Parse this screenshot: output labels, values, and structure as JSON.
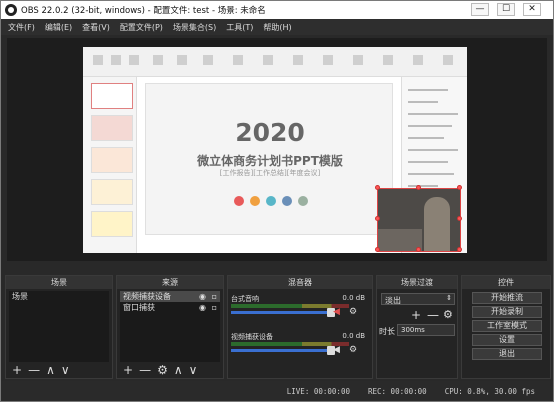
{
  "window": {
    "title": "OBS 22.0.2 (32-bit, windows) - 配置文件: test - 场景: 未命名",
    "minimize": "—",
    "maximize": "☐",
    "close": "✕"
  },
  "menu": [
    "文件(F)",
    "编辑(E)",
    "查看(V)",
    "配置文件(P)",
    "场景集合(S)",
    "工具(T)",
    "帮助(H)"
  ],
  "preview": {
    "slide_title": "2020",
    "slide_subtitle": "微立体商务计划书PPT模版",
    "slide_tagline": "[工作报告][工作总结][年度会议]",
    "dot_colors": [
      "#e85a5a",
      "#f0a040",
      "#58b6c8",
      "#6a8fb8",
      "#9ab0a0"
    ]
  },
  "panels": {
    "scenes": {
      "title": "场景",
      "items": [
        "场景"
      ]
    },
    "sources": {
      "title": "来源",
      "items": [
        "视频捕获设备",
        "窗口捕获"
      ]
    },
    "mixer": {
      "title": "混音器",
      "channels": [
        {
          "name": "台式音响",
          "db": "0.0 dB"
        },
        {
          "name": "视频捕获设备",
          "db": "0.0 dB"
        }
      ]
    },
    "transitions": {
      "title": "场景过渡",
      "selected": "淡出",
      "duration_label": "时长",
      "duration_value": "300ms"
    },
    "controls": {
      "title": "控件",
      "buttons": [
        "开始推流",
        "开始录制",
        "工作室模式",
        "设置",
        "退出"
      ]
    }
  },
  "footer_icons": {
    "add": "+",
    "remove": "—",
    "up": "∧",
    "down": "∨",
    "gear": "⚙"
  },
  "status": {
    "live": "LIVE: 00:00:00",
    "rec": "REC: 00:00:00",
    "cpu": "CPU: 0.8%, 30.00 fps"
  }
}
